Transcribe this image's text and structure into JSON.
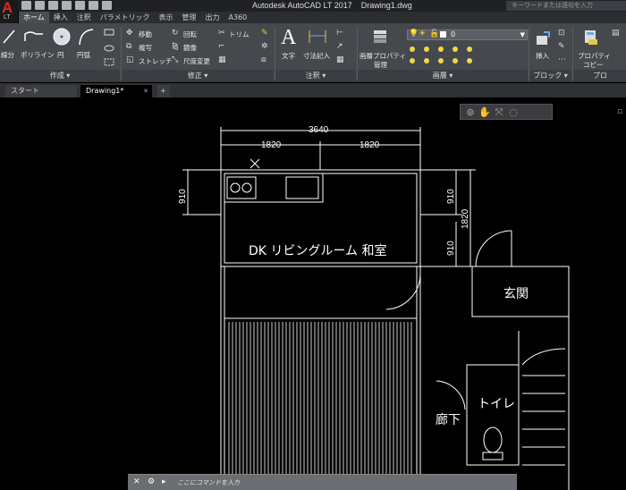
{
  "app": {
    "logo_letter": "A",
    "logo_sub": "LT",
    "window_title": "Autodesk AutoCAD LT 2017    Drawing1.dwg",
    "search_placeholder": "キーワードまたは語句を入力"
  },
  "ribbon_tabs": [
    "ホーム",
    "挿入",
    "注釈",
    "パラメトリック",
    "表示",
    "管理",
    "出力",
    "A360"
  ],
  "ribbon": {
    "draw": {
      "line": "線分",
      "polyline": "ポリライン",
      "circle": "円",
      "arc": "円弧",
      "footer": "作成 ▾"
    },
    "modify": {
      "move": "移動",
      "copy": "複写",
      "stretch": "ストレッチ",
      "rotate": "回転",
      "mirror": "鏡像",
      "scale": "尺度変更",
      "trim": "トリム",
      "footer": "修正 ▾"
    },
    "annotation": {
      "text": "文字",
      "dimension": "寸法記入",
      "footer": "注釈 ▾"
    },
    "layers": {
      "properties": "画層プロパティ",
      "properties_line2": "管理",
      "current_layer": "0",
      "footer": "画層 ▾"
    },
    "block": {
      "insert": "挿入",
      "footer": "ブロック ▾"
    },
    "properties": {
      "label": "プロパティ",
      "label_line2": "コピー",
      "footer": "プロ"
    }
  },
  "file_tabs": {
    "start": "スタート",
    "drawing": "Drawing1*",
    "close": "✕",
    "add": "+"
  },
  "drawing": {
    "dims": {
      "total_width": "3640",
      "left_half": "1820",
      "right_half": "1820",
      "left_vertical": "910",
      "right_upper": "910",
      "right_lower": "910",
      "right_total": "1820"
    },
    "rooms": {
      "main": "DK リビングルーム 和室",
      "entrance": "玄関",
      "toilet": "トイレ",
      "hallway": "廊下"
    }
  },
  "command_line": {
    "placeholder": "ここにコマンドを入力"
  }
}
